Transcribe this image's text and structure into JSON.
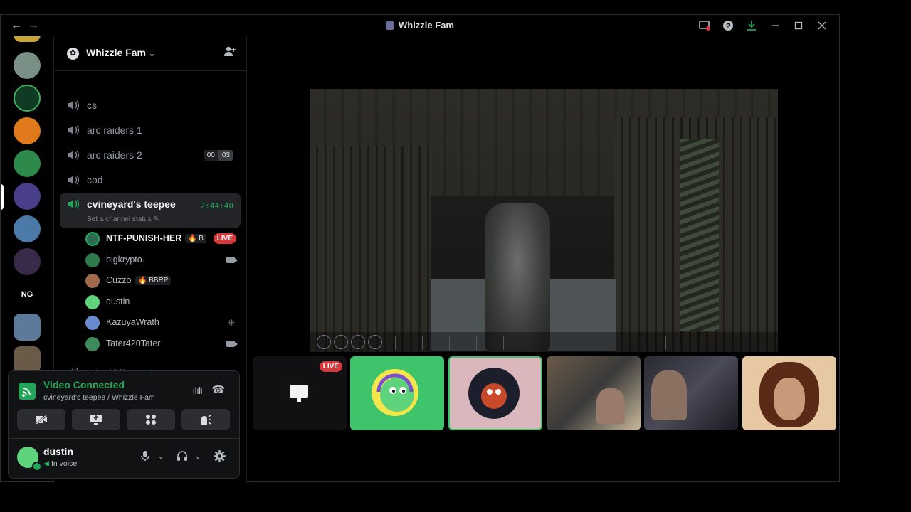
{
  "window": {
    "title": "Whizzle Fam",
    "controls": [
      "inbox-icon",
      "help-icon",
      "download-icon",
      "minimize-icon",
      "maximize-icon",
      "close-icon"
    ]
  },
  "guild": {
    "name": "Whizzle Fam"
  },
  "channels": [
    {
      "name": "cs"
    },
    {
      "name": "arc raiders 1"
    },
    {
      "name": "arc raiders 2",
      "counts": [
        "00",
        "03"
      ]
    },
    {
      "name": "cod"
    },
    {
      "name": "cvineyard's teepee",
      "timer": "2:44:40",
      "status": "Set a channel status"
    },
    {
      "name": "tater420's goat pen"
    }
  ],
  "members": [
    {
      "name": "NTF-PUNISH-HER",
      "tag": "🔥 B",
      "badge": "LIVE"
    },
    {
      "name": "bigkrypto.",
      "indicator": "camera-icon"
    },
    {
      "name": "Cuzzo",
      "tag": "🔥 BBRP"
    },
    {
      "name": "dustin"
    },
    {
      "name": "KazuyaWrath",
      "indicator": "playstation-icon"
    },
    {
      "name": "Tater420Tater",
      "indicator": "camera-icon"
    }
  ],
  "voice": {
    "title": "Video Connected",
    "subtitle": "cvineyard's teepee / Whizzle Fam"
  },
  "user": {
    "name": "dustin",
    "status": "In voice"
  },
  "tiles": [
    {
      "label": "LIVE"
    }
  ],
  "colors": {
    "accent_green": "#23a559",
    "live_red": "#da373c",
    "active_channel_bg": "#232428"
  }
}
